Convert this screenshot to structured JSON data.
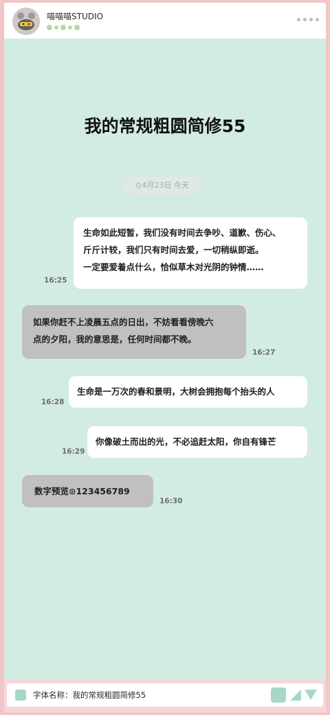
{
  "header": {
    "app_title": "喵喵喵STUDIO",
    "avatar_icon": "cat-avatar-icon",
    "more_icon": "more-dots-icon"
  },
  "main": {
    "font_title": "我的常规粗圆简修55",
    "date_pill": "⊙4月23日 今天",
    "messages": [
      {
        "side": "right",
        "style": "white",
        "lines": [
          "生命如此短暂，我们没有时间去争吵、道歉、伤心、",
          "斤斤计较，我们只有时间去爱，一切稍纵即逝。",
          "一定要爱着点什么，恰似草木对光阴的钟情……"
        ],
        "time": "16:25"
      },
      {
        "side": "left",
        "style": "gray",
        "lines": [
          "如果你赶不上凌晨五点的日出，不妨看看傍晚六",
          "点的夕阳，我的意思是，任何时间都不晚。"
        ],
        "time": "16:27"
      },
      {
        "side": "right",
        "style": "white",
        "lines": [
          "生命是一万次的春和景明，大树会拥抱每个抬头的人"
        ],
        "time": "16:28"
      },
      {
        "side": "right",
        "style": "white",
        "lines": [
          "你像破土而出的光，不必追赶太阳，你自有锋芒"
        ],
        "time": "16:29"
      },
      {
        "side": "left",
        "style": "gray",
        "lines": [
          "数字预览⊙123456789"
        ],
        "time": "16:30"
      }
    ]
  },
  "footer": {
    "font_name_text": "字体名称：我的常规粗圆简修55"
  },
  "colors": {
    "border_pink": "#f2c6c9",
    "chat_bg": "#d3ece2",
    "accent_mint": "#a7d8c5",
    "bubble_gray": "#c0c0c0",
    "dot_green": "#b6d9a5"
  }
}
